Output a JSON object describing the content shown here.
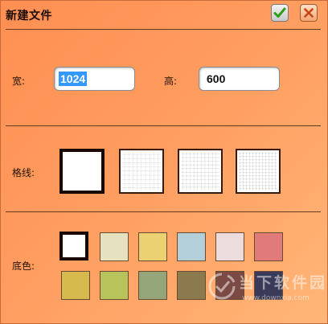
{
  "dialog": {
    "title": "新建文件",
    "ok_icon": "checkmark-icon",
    "close_icon": "close-x-icon"
  },
  "size": {
    "width_label": "宽:",
    "width_value": "1024",
    "height_label": "高:",
    "height_value": "600"
  },
  "grid": {
    "label": "格线:",
    "options": [
      "none",
      "fine-dotted",
      "medium-dotted",
      "dense-dotted"
    ],
    "selected_index": 0
  },
  "background": {
    "label": "底色:",
    "colors": [
      "#ffffff",
      "#e6e2bf",
      "#ebd171",
      "#b3d0da",
      "#ecdcdd",
      "#e07b79",
      "#d6ba4d",
      "#b6c45b",
      "#95a57a",
      "#8b7a4e",
      "#7c4a44",
      "#3a3b58"
    ],
    "selected_index": 0
  },
  "watermark": {
    "text": "当下软件园",
    "url": "www.downxia.com"
  },
  "colors": {
    "dialog_bg": "#ff9c5f",
    "ok_check": "#2e9e1c",
    "close_x": "#c8461a",
    "selection_highlight": "#3399ff"
  }
}
